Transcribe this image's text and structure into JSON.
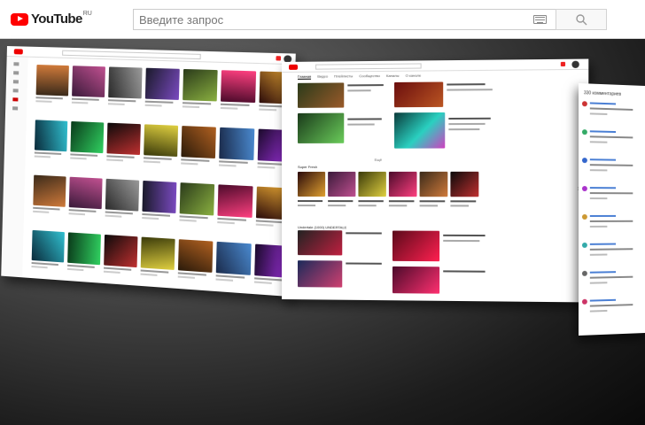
{
  "header": {
    "logo_text": "YouTube",
    "region": "RU",
    "search_placeholder": "Введите запрос"
  },
  "icons": {
    "keyboard": "keyboard-icon",
    "search": "search-icon",
    "logo": "youtube-logo-icon"
  },
  "colors": {
    "brand_red": "#ff0000",
    "background_dark": "#1c1c1c",
    "link_blue": "#3366cc"
  },
  "panel_b": {
    "tabs": [
      "Главная",
      "Видео",
      "Плейлисты",
      "Сообщество",
      "Каналы",
      "О канале"
    ],
    "section_one": "Super Fresh",
    "section_two": "Undertale (1000) UNDERTALE",
    "more_label": "Ещё"
  },
  "panel_c": {
    "title": "330 комментариев"
  }
}
